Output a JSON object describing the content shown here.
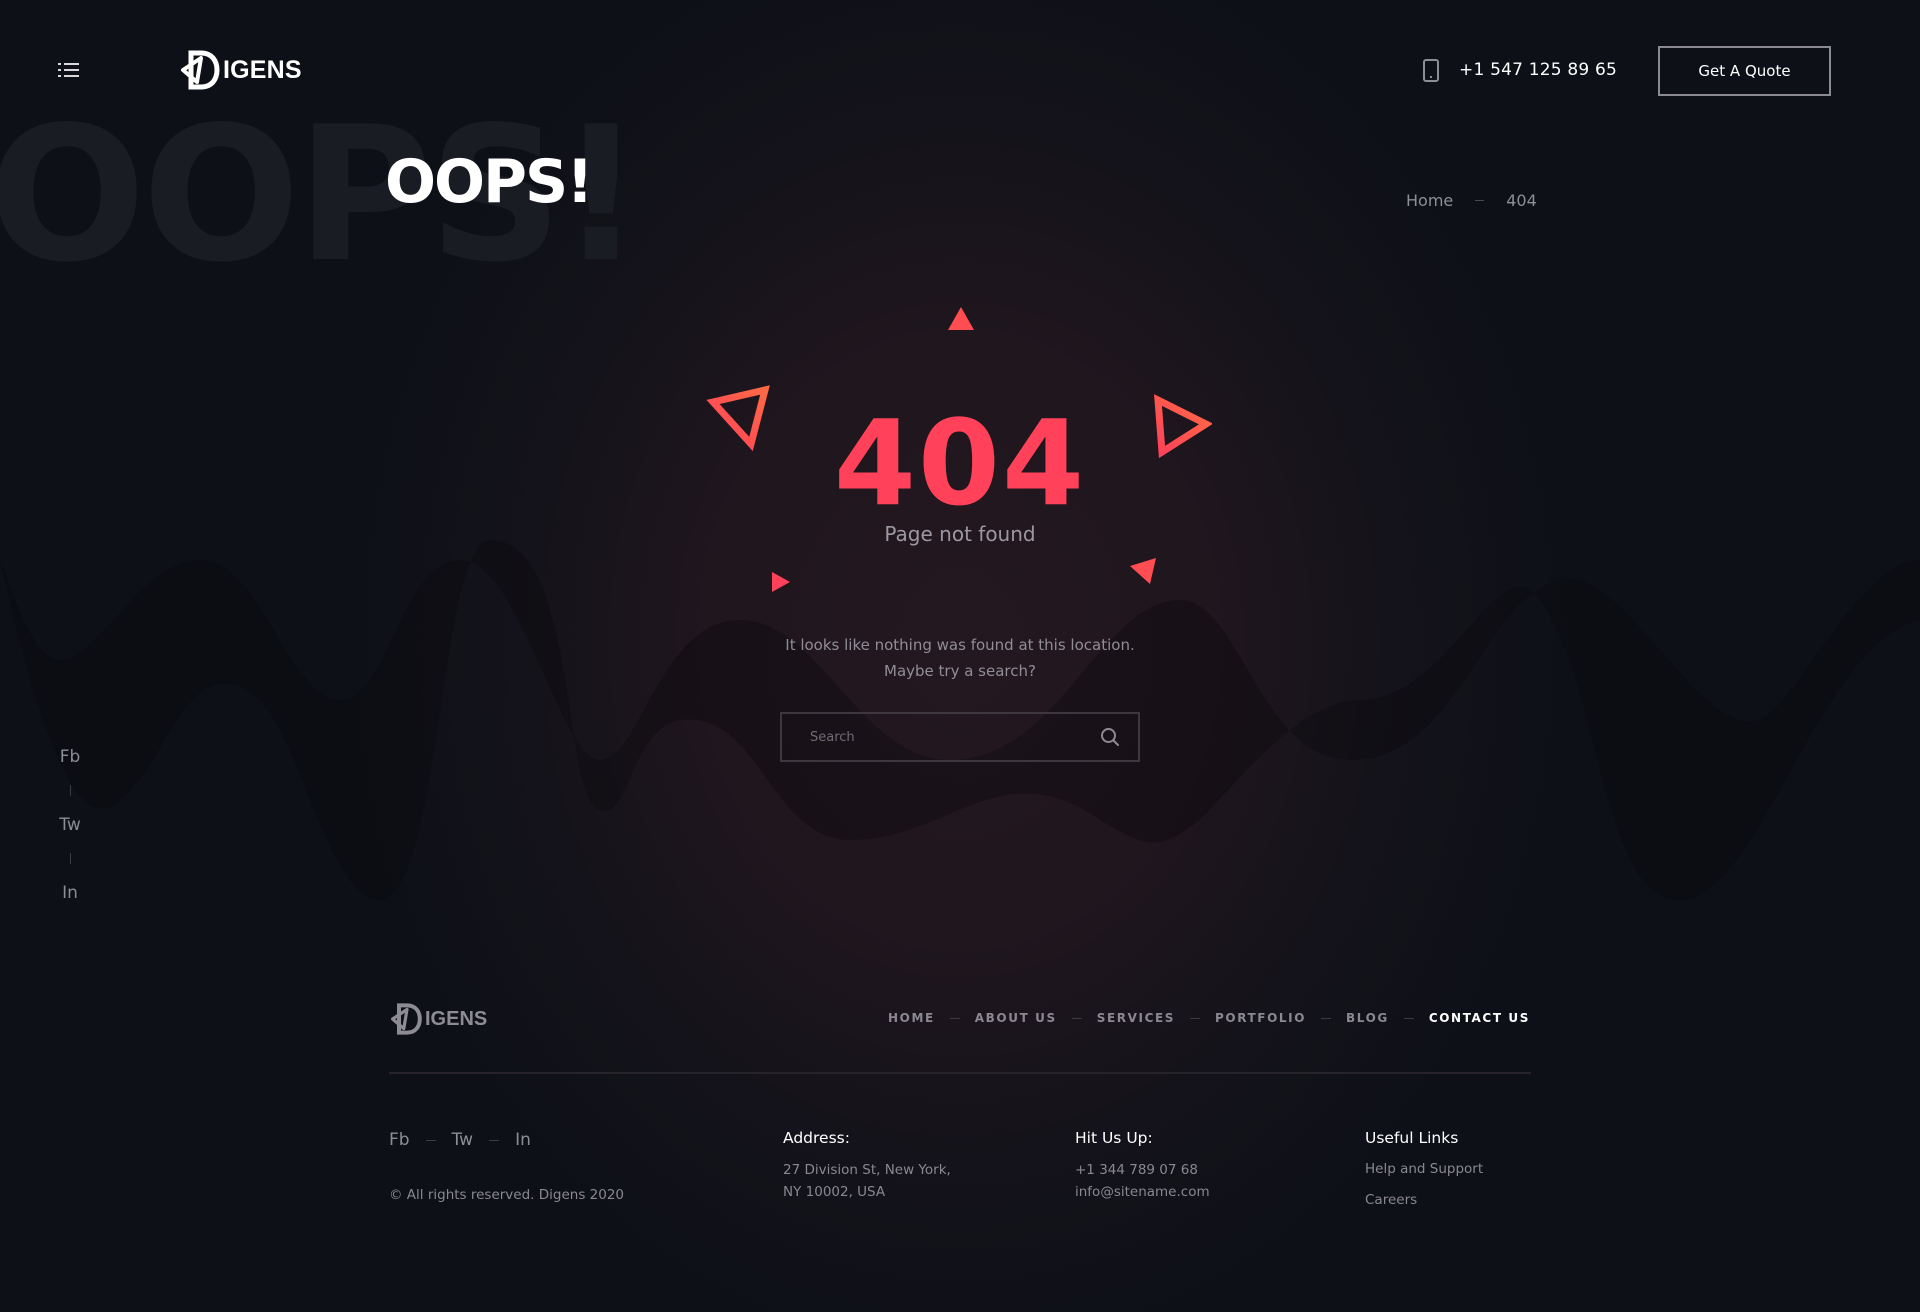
{
  "header": {
    "brand": "IGENS",
    "phone": "+1 547 125 89 65",
    "quote_button": "Get A Quote"
  },
  "hero": {
    "background_title": "OOPS!",
    "title": "OOPS!",
    "breadcrumb": [
      {
        "label": "Home"
      },
      {
        "label": "404"
      }
    ]
  },
  "error": {
    "code": "404",
    "subtitle": "Page not found",
    "message_line1": "It looks like nothing was found at this location.",
    "message_line2": "Maybe try a search?",
    "accent_color": "#ff4159"
  },
  "search": {
    "placeholder": "Search",
    "value": ""
  },
  "side_social": [
    {
      "label": "Fb"
    },
    {
      "label": "Tw"
    },
    {
      "label": "In"
    }
  ],
  "footer": {
    "brand": "IGENS",
    "nav": [
      {
        "label": "HOME",
        "active": false
      },
      {
        "label": "ABOUT US",
        "active": false
      },
      {
        "label": "SERVICES",
        "active": false
      },
      {
        "label": "PORTFOLIO",
        "active": false
      },
      {
        "label": "BLOG",
        "active": false
      },
      {
        "label": "CONTACT US",
        "active": true
      }
    ],
    "social": [
      {
        "label": "Fb"
      },
      {
        "label": "Tw"
      },
      {
        "label": "In"
      }
    ],
    "copyright": "© All rights reserved. Digens 2020",
    "address": {
      "heading": "Address:",
      "line1": "27 Division St, New York,",
      "line2": "NY 10002, USA"
    },
    "contact": {
      "heading": "Hit Us Up:",
      "phone": "+1 344 789 07 68",
      "email": "info@sitename.com"
    },
    "useful_links": {
      "heading": "Useful Links",
      "links": [
        "Help and Support",
        "Careers"
      ]
    }
  }
}
